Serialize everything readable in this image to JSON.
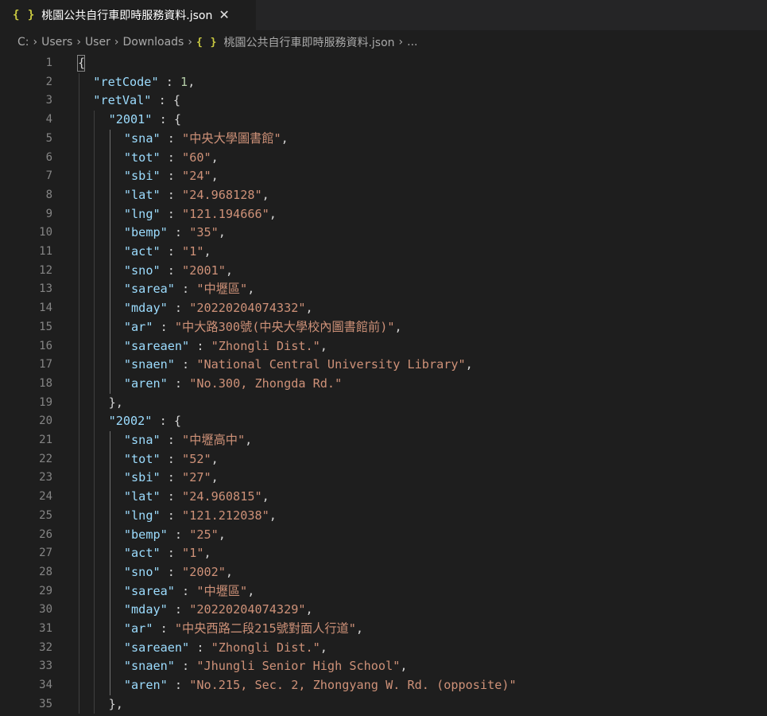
{
  "tab": {
    "title": "桃園公共自行車即時服務資料.json",
    "icon": "json-braces-icon",
    "icon_glyph": "{ }",
    "close_glyph": "✕"
  },
  "breadcrumb": {
    "items": [
      "C:",
      "Users",
      "User",
      "Downloads"
    ],
    "file_icon_glyph": "{ }",
    "file": "桃園公共自行車即時服務資料.json",
    "more": "...",
    "separator": "›"
  },
  "editor": {
    "lines": [
      {
        "n": "1",
        "indent": 0,
        "tokens": [
          {
            "t": "{",
            "c": "punc"
          }
        ]
      },
      {
        "n": "2",
        "indent": 1,
        "tokens": [
          {
            "t": "\"retCode\"",
            "c": "key"
          },
          {
            "t": " : ",
            "c": "punc"
          },
          {
            "t": "1",
            "c": "num"
          },
          {
            "t": ",",
            "c": "punc"
          }
        ]
      },
      {
        "n": "3",
        "indent": 1,
        "tokens": [
          {
            "t": "\"retVal\"",
            "c": "key"
          },
          {
            "t": " : {",
            "c": "punc"
          }
        ]
      },
      {
        "n": "4",
        "indent": 2,
        "tokens": [
          {
            "t": "\"2001\"",
            "c": "key"
          },
          {
            "t": " : {",
            "c": "punc"
          }
        ]
      },
      {
        "n": "5",
        "indent": 3,
        "tokens": [
          {
            "t": "\"sna\"",
            "c": "key"
          },
          {
            "t": " : ",
            "c": "punc"
          },
          {
            "t": "\"中央大學圖書館\"",
            "c": "str"
          },
          {
            "t": ",",
            "c": "punc"
          }
        ]
      },
      {
        "n": "6",
        "indent": 3,
        "tokens": [
          {
            "t": "\"tot\"",
            "c": "key"
          },
          {
            "t": " : ",
            "c": "punc"
          },
          {
            "t": "\"60\"",
            "c": "str"
          },
          {
            "t": ",",
            "c": "punc"
          }
        ]
      },
      {
        "n": "7",
        "indent": 3,
        "tokens": [
          {
            "t": "\"sbi\"",
            "c": "key"
          },
          {
            "t": " : ",
            "c": "punc"
          },
          {
            "t": "\"24\"",
            "c": "str"
          },
          {
            "t": ",",
            "c": "punc"
          }
        ]
      },
      {
        "n": "8",
        "indent": 3,
        "tokens": [
          {
            "t": "\"lat\"",
            "c": "key"
          },
          {
            "t": " : ",
            "c": "punc"
          },
          {
            "t": "\"24.968128\"",
            "c": "str"
          },
          {
            "t": ",",
            "c": "punc"
          }
        ]
      },
      {
        "n": "9",
        "indent": 3,
        "tokens": [
          {
            "t": "\"lng\"",
            "c": "key"
          },
          {
            "t": " : ",
            "c": "punc"
          },
          {
            "t": "\"121.194666\"",
            "c": "str"
          },
          {
            "t": ",",
            "c": "punc"
          }
        ]
      },
      {
        "n": "10",
        "indent": 3,
        "tokens": [
          {
            "t": "\"bemp\"",
            "c": "key"
          },
          {
            "t": " : ",
            "c": "punc"
          },
          {
            "t": "\"35\"",
            "c": "str"
          },
          {
            "t": ",",
            "c": "punc"
          }
        ]
      },
      {
        "n": "11",
        "indent": 3,
        "tokens": [
          {
            "t": "\"act\"",
            "c": "key"
          },
          {
            "t": " : ",
            "c": "punc"
          },
          {
            "t": "\"1\"",
            "c": "str"
          },
          {
            "t": ",",
            "c": "punc"
          }
        ]
      },
      {
        "n": "12",
        "indent": 3,
        "tokens": [
          {
            "t": "\"sno\"",
            "c": "key"
          },
          {
            "t": " : ",
            "c": "punc"
          },
          {
            "t": "\"2001\"",
            "c": "str"
          },
          {
            "t": ",",
            "c": "punc"
          }
        ]
      },
      {
        "n": "13",
        "indent": 3,
        "tokens": [
          {
            "t": "\"sarea\"",
            "c": "key"
          },
          {
            "t": " : ",
            "c": "punc"
          },
          {
            "t": "\"中壢區\"",
            "c": "str"
          },
          {
            "t": ",",
            "c": "punc"
          }
        ]
      },
      {
        "n": "14",
        "indent": 3,
        "tokens": [
          {
            "t": "\"mday\"",
            "c": "key"
          },
          {
            "t": " : ",
            "c": "punc"
          },
          {
            "t": "\"20220204074332\"",
            "c": "str"
          },
          {
            "t": ",",
            "c": "punc"
          }
        ]
      },
      {
        "n": "15",
        "indent": 3,
        "tokens": [
          {
            "t": "\"ar\"",
            "c": "key"
          },
          {
            "t": " : ",
            "c": "punc"
          },
          {
            "t": "\"中大路300號(中央大學校內圖書館前)\"",
            "c": "str"
          },
          {
            "t": ",",
            "c": "punc"
          }
        ]
      },
      {
        "n": "16",
        "indent": 3,
        "tokens": [
          {
            "t": "\"sareaen\"",
            "c": "key"
          },
          {
            "t": " : ",
            "c": "punc"
          },
          {
            "t": "\"Zhongli Dist.\"",
            "c": "str"
          },
          {
            "t": ",",
            "c": "punc"
          }
        ]
      },
      {
        "n": "17",
        "indent": 3,
        "tokens": [
          {
            "t": "\"snaen\"",
            "c": "key"
          },
          {
            "t": " : ",
            "c": "punc"
          },
          {
            "t": "\"National Central University Library\"",
            "c": "str"
          },
          {
            "t": ",",
            "c": "punc"
          }
        ]
      },
      {
        "n": "18",
        "indent": 3,
        "tokens": [
          {
            "t": "\"aren\"",
            "c": "key"
          },
          {
            "t": " : ",
            "c": "punc"
          },
          {
            "t": "\"No.300, Zhongda Rd.\"",
            "c": "str"
          }
        ]
      },
      {
        "n": "19",
        "indent": 2,
        "tokens": [
          {
            "t": "},",
            "c": "punc"
          }
        ]
      },
      {
        "n": "20",
        "indent": 2,
        "tokens": [
          {
            "t": "\"2002\"",
            "c": "key"
          },
          {
            "t": " : {",
            "c": "punc"
          }
        ]
      },
      {
        "n": "21",
        "indent": 3,
        "tokens": [
          {
            "t": "\"sna\"",
            "c": "key"
          },
          {
            "t": " : ",
            "c": "punc"
          },
          {
            "t": "\"中壢高中\"",
            "c": "str"
          },
          {
            "t": ",",
            "c": "punc"
          }
        ]
      },
      {
        "n": "22",
        "indent": 3,
        "tokens": [
          {
            "t": "\"tot\"",
            "c": "key"
          },
          {
            "t": " : ",
            "c": "punc"
          },
          {
            "t": "\"52\"",
            "c": "str"
          },
          {
            "t": ",",
            "c": "punc"
          }
        ]
      },
      {
        "n": "23",
        "indent": 3,
        "tokens": [
          {
            "t": "\"sbi\"",
            "c": "key"
          },
          {
            "t": " : ",
            "c": "punc"
          },
          {
            "t": "\"27\"",
            "c": "str"
          },
          {
            "t": ",",
            "c": "punc"
          }
        ]
      },
      {
        "n": "24",
        "indent": 3,
        "tokens": [
          {
            "t": "\"lat\"",
            "c": "key"
          },
          {
            "t": " : ",
            "c": "punc"
          },
          {
            "t": "\"24.960815\"",
            "c": "str"
          },
          {
            "t": ",",
            "c": "punc"
          }
        ]
      },
      {
        "n": "25",
        "indent": 3,
        "tokens": [
          {
            "t": "\"lng\"",
            "c": "key"
          },
          {
            "t": " : ",
            "c": "punc"
          },
          {
            "t": "\"121.212038\"",
            "c": "str"
          },
          {
            "t": ",",
            "c": "punc"
          }
        ]
      },
      {
        "n": "26",
        "indent": 3,
        "tokens": [
          {
            "t": "\"bemp\"",
            "c": "key"
          },
          {
            "t": " : ",
            "c": "punc"
          },
          {
            "t": "\"25\"",
            "c": "str"
          },
          {
            "t": ",",
            "c": "punc"
          }
        ]
      },
      {
        "n": "27",
        "indent": 3,
        "tokens": [
          {
            "t": "\"act\"",
            "c": "key"
          },
          {
            "t": " : ",
            "c": "punc"
          },
          {
            "t": "\"1\"",
            "c": "str"
          },
          {
            "t": ",",
            "c": "punc"
          }
        ]
      },
      {
        "n": "28",
        "indent": 3,
        "tokens": [
          {
            "t": "\"sno\"",
            "c": "key"
          },
          {
            "t": " : ",
            "c": "punc"
          },
          {
            "t": "\"2002\"",
            "c": "str"
          },
          {
            "t": ",",
            "c": "punc"
          }
        ]
      },
      {
        "n": "29",
        "indent": 3,
        "tokens": [
          {
            "t": "\"sarea\"",
            "c": "key"
          },
          {
            "t": " : ",
            "c": "punc"
          },
          {
            "t": "\"中壢區\"",
            "c": "str"
          },
          {
            "t": ",",
            "c": "punc"
          }
        ]
      },
      {
        "n": "30",
        "indent": 3,
        "tokens": [
          {
            "t": "\"mday\"",
            "c": "key"
          },
          {
            "t": " : ",
            "c": "punc"
          },
          {
            "t": "\"20220204074329\"",
            "c": "str"
          },
          {
            "t": ",",
            "c": "punc"
          }
        ]
      },
      {
        "n": "31",
        "indent": 3,
        "tokens": [
          {
            "t": "\"ar\"",
            "c": "key"
          },
          {
            "t": " : ",
            "c": "punc"
          },
          {
            "t": "\"中央西路二段215號對面人行道\"",
            "c": "str"
          },
          {
            "t": ",",
            "c": "punc"
          }
        ]
      },
      {
        "n": "32",
        "indent": 3,
        "tokens": [
          {
            "t": "\"sareaen\"",
            "c": "key"
          },
          {
            "t": " : ",
            "c": "punc"
          },
          {
            "t": "\"Zhongli Dist.\"",
            "c": "str"
          },
          {
            "t": ",",
            "c": "punc"
          }
        ]
      },
      {
        "n": "33",
        "indent": 3,
        "tokens": [
          {
            "t": "\"snaen\"",
            "c": "key"
          },
          {
            "t": " : ",
            "c": "punc"
          },
          {
            "t": "\"Jhungli Senior High School\"",
            "c": "str"
          },
          {
            "t": ",",
            "c": "punc"
          }
        ]
      },
      {
        "n": "34",
        "indent": 3,
        "tokens": [
          {
            "t": "\"aren\"",
            "c": "key"
          },
          {
            "t": " : ",
            "c": "punc"
          },
          {
            "t": "\"No.215, Sec. 2, Zhongyang W. Rd. (opposite)\"",
            "c": "str"
          }
        ]
      },
      {
        "n": "35",
        "indent": 2,
        "tokens": [
          {
            "t": "},",
            "c": "punc"
          }
        ]
      }
    ]
  },
  "colors": {
    "background": "#1e1e1e",
    "key": "#9cdcfe",
    "string": "#ce9178",
    "number": "#b5cea8",
    "line_number": "#858585",
    "json_icon": "#cbcb41"
  }
}
